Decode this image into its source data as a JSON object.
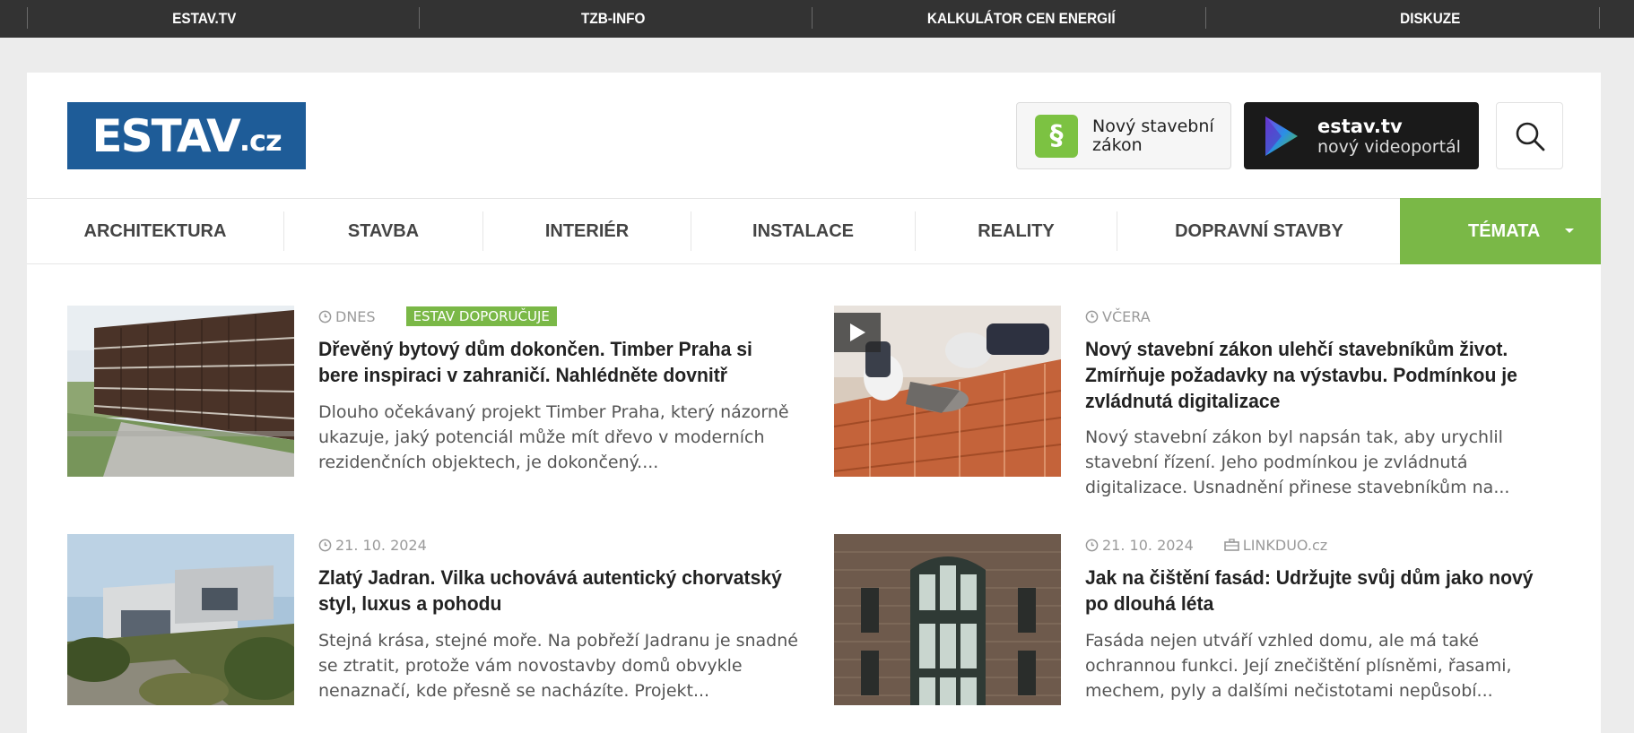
{
  "topbar": {
    "items": [
      "ESTAV.TV",
      "TZB-INFO",
      "KALKULÁTOR CEN ENERGIÍ",
      "DISKUZE"
    ]
  },
  "header": {
    "logo": {
      "main": "ESTAV",
      "suffix": ".cz"
    },
    "promo_law": {
      "icon": "§",
      "line1": "Nový stavební",
      "line2": "zákon"
    },
    "promo_tv": {
      "line1": "estav.tv",
      "line2": "nový videoportál"
    }
  },
  "nav": {
    "items": [
      "ARCHITEKTURA",
      "STAVBA",
      "INTERIÉR",
      "INSTALACE",
      "REALITY",
      "DOPRAVNÍ STAVBY"
    ],
    "themes": "TÉMATA"
  },
  "articles": [
    {
      "date": "DNES",
      "badge": "ESTAV DOPORUČUJE",
      "title": "Dřevěný bytový dům dokončen. Timber Praha si bere inspiraci v zahraničí. Nahlédněte dovnitř",
      "desc": "Dlouho očekávaný projekt Timber Praha, který názorně ukazuje, jaký potenciál může mít dřevo v moderních rezidenčních objektech, je dokončený...."
    },
    {
      "date": "VČERA",
      "title": "Nový stavební zákon ulehčí stavebníkům život. Zmírňuje požadavky na výstavbu. Podmínkou je zvládnutá digitalizace",
      "desc": "Nový stavební zákon byl napsán tak, aby urychlil stavební řízení. Jeho podmínkou je zvládnutá digitalizace. Usnadnění přinese stavebníkům na..."
    },
    {
      "date": "21. 10. 2024",
      "title": "Zlatý Jadran. Vilka uchovává autentický chorvatský styl, luxus a pohodu",
      "desc": "Stejná krása, stejné moře. Na pobřeží Jadranu je snadné se ztratit, protože vám novostavby domů obvykle nenaznačí, kde přesně se nacházíte. Projekt..."
    },
    {
      "date": "21. 10. 2024",
      "source": "LINKDUO.cz",
      "title": "Jak na čištění fasád: Udržujte svůj dům jako nový po dlouhá léta",
      "desc": "Fasáda nejen utváří vzhled domu, ale má také ochrannou funkci. Její znečištění plísněmi, řasami, mechem, pyly a dalšími nečistotami nepůsobí..."
    }
  ],
  "colors": {
    "topbar": "#333333",
    "brand_blue": "#1e5c98",
    "accent_green": "#7ab847"
  }
}
